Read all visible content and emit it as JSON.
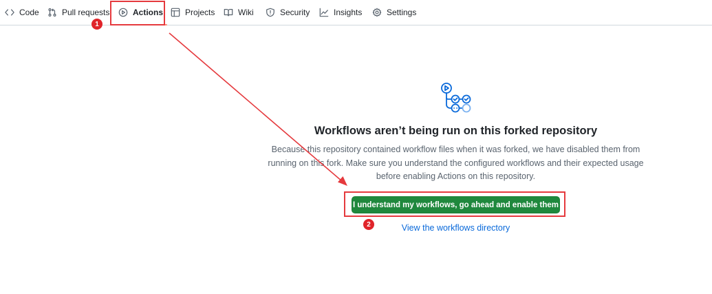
{
  "tabs": [
    {
      "label": "Code",
      "icon": "code-icon"
    },
    {
      "label": "Pull requests",
      "icon": "pull-request-icon"
    },
    {
      "label": "Actions",
      "icon": "play-icon",
      "active": true
    },
    {
      "label": "Projects",
      "icon": "table-icon"
    },
    {
      "label": "Wiki",
      "icon": "book-icon"
    },
    {
      "label": "Security",
      "icon": "shield-icon"
    },
    {
      "label": "Insights",
      "icon": "graph-icon"
    },
    {
      "label": "Settings",
      "icon": "gear-icon"
    }
  ],
  "annotations": {
    "step1": "1",
    "step2": "2",
    "color": "#e5393d"
  },
  "blankslate": {
    "icon": "workflow-icon",
    "title": "Workflows aren’t being run on this forked repository",
    "description": "Because this repository contained workflow files when it was forked, we have disabled them from running on this fork. Make sure you understand the configured workflows and their expected usage before enabling Actions on this repository.",
    "enable_button": "I understand my workflows, go ahead and enable them",
    "directory_link": "View the workflows directory"
  },
  "colors": {
    "primary_button": "#1f883d",
    "link": "#0969da",
    "active_tab_underline": "#fd8c73",
    "icon_blue": "#0969da"
  }
}
